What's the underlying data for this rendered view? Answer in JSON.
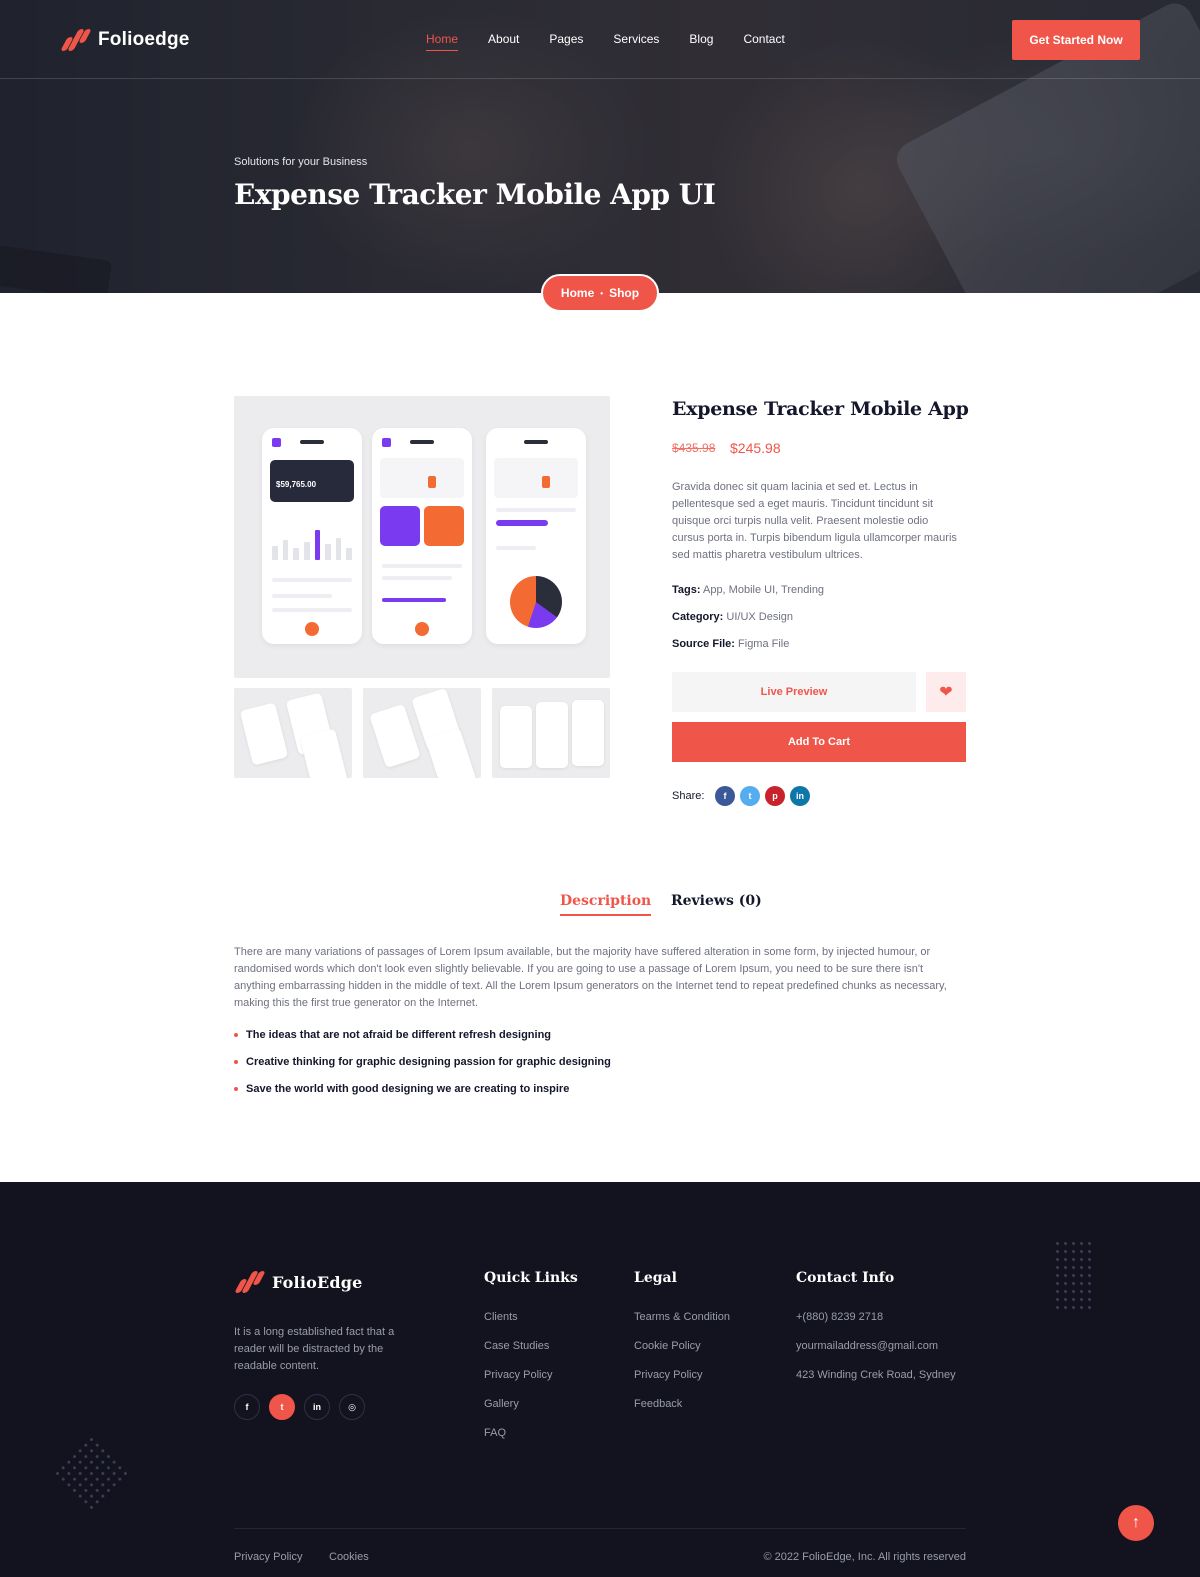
{
  "header": {
    "logo_text": "Folioedge",
    "nav": [
      "Home",
      "About",
      "Pages",
      "Services",
      "Blog",
      "Contact"
    ],
    "cta_label": "Get Started Now"
  },
  "hero": {
    "subtitle": "Solutions for your Business",
    "title": "Expense Tracker Mobile App UI"
  },
  "breadcrumb": {
    "home": "Home",
    "separator": "•",
    "current": "Shop"
  },
  "product": {
    "title": "Expense Tracker Mobile App",
    "old_price": "$435.98",
    "new_price": "$245.98",
    "description": "Gravida donec sit quam lacinia et sed et. Lectus in pellentesque sed a eget mauris. Tincidunt tincidunt sit quisque orci turpis nulla velit. Praesent molestie odio cursus porta in. Turpis bibendum ligula ullamcorper mauris sed mattis pharetra vestibulum ultrices.",
    "mockup_balance": "$59,765.00",
    "tags_label": "Tags:",
    "tags_value": "App, Mobile UI, Trending",
    "category_label": "Category:",
    "category_value": "UI/UX Design",
    "source_label": "Source File:",
    "source_value": "Figma File",
    "live_preview_label": "Live Preview",
    "add_to_cart_label": "Add To Cart",
    "share_label": "Share:",
    "share_icons": [
      "facebook-icon",
      "twitter-icon",
      "pinterest-icon",
      "linkedin-icon"
    ]
  },
  "tabs": {
    "description": "Description",
    "reviews": "Reviews (0)"
  },
  "description": {
    "text": "There are many variations of passages of Lorem Ipsum available, but the majority have suffered alteration in some form, by injected humour, or randomised words which don't look even slightly believable. If you are going to use a passage of Lorem Ipsum, you need to be sure there isn't anything embarrassing hidden in the middle of text. All the Lorem Ipsum generators on the Internet tend to repeat predefined chunks as necessary, making this the first true generator on the Internet.",
    "bullets": [
      "The ideas that are not afraid be different refresh designing",
      "Creative thinking for graphic designing passion for graphic designing",
      "Save the world with good designing we are creating to inspire"
    ]
  },
  "footer": {
    "logo_text": "FolioEdge",
    "about": "It is a long established fact that a reader will be distracted by the readable content.",
    "quick_links_title": "Quick Links",
    "quick_links": [
      "Clients",
      "Case Studies",
      "Privacy Policy",
      "Gallery",
      "FAQ"
    ],
    "legal_title": "Legal",
    "legal": [
      "Tearms & Condition",
      "Cookie Policy",
      "Privacy Policy",
      "Feedback"
    ],
    "contact_title": "Contact Info",
    "contact": [
      "+(880) 8239 2718",
      "yourmailaddress@gmail.com",
      "423 Winding Crek Road, Sydney"
    ],
    "bottom_links": [
      "Privacy Policy",
      "Cookies"
    ],
    "copyright": "© 2022 FolioEdge, Inc. All rights reserved"
  },
  "colors": {
    "accent": "#f0554a",
    "dark": "#12131f",
    "text": "#14172b",
    "muted": "#6e7180"
  }
}
